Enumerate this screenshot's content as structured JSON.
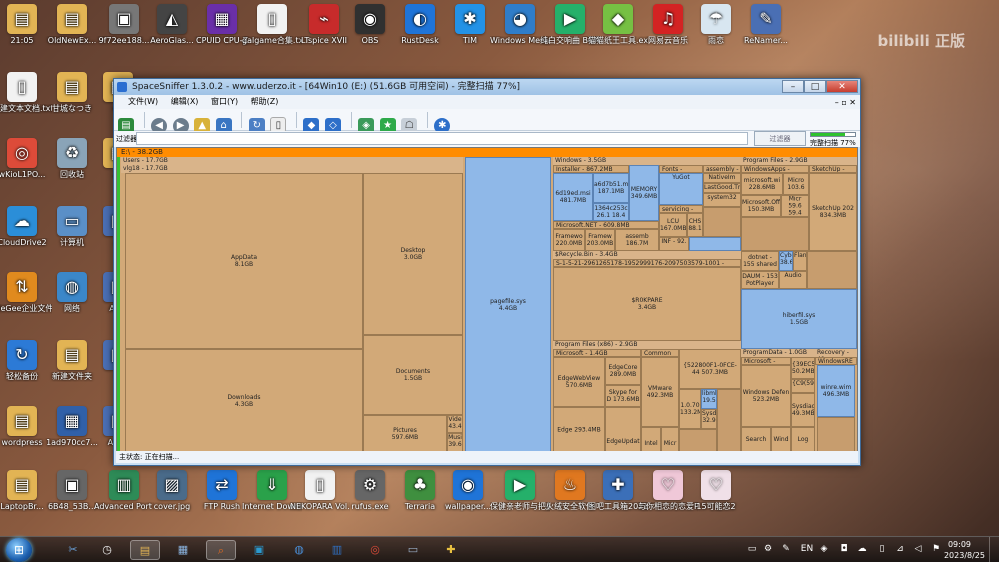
{
  "watermark": "bilibili 正版",
  "desktop_icons": [
    {
      "label": "21:05",
      "color": "#e2b454",
      "glyph": "▤"
    },
    {
      "label": "OldNewEx...",
      "color": "#e2b454",
      "glyph": "▤"
    },
    {
      "label": "9f72ee188...",
      "color": "#777777",
      "glyph": "▣"
    },
    {
      "label": "AeroGlas...",
      "color": "#444444",
      "glyph": "◭"
    },
    {
      "label": "CPUID CPU-Z",
      "color": "#6a2fa8",
      "glyph": "▦"
    },
    {
      "label": "galgame合集.txt",
      "color": "#f2f2f2",
      "glyph": "▯"
    },
    {
      "label": "LTspice XVII",
      "color": "#c72b2b",
      "glyph": "⌁"
    },
    {
      "label": "OBS",
      "color": "#303030",
      "glyph": "◉"
    },
    {
      "label": "RustDesk",
      "color": "#1f74d8",
      "glyph": "◐"
    },
    {
      "label": "TIM",
      "color": "#2392e6",
      "glyph": "✱"
    },
    {
      "label": "Windows Media ...",
      "color": "#2f7dc9",
      "glyph": "◕"
    },
    {
      "label": "纯白交响曲 BGM1.wav",
      "color": "#25b06a",
      "glyph": "▶"
    },
    {
      "label": "猫猫纸王工具.exe",
      "color": "#76c043",
      "glyph": "◆"
    },
    {
      "label": "网易云音乐",
      "color": "#d32323",
      "glyph": "♫"
    },
    {
      "label": "雨恋",
      "color": "#d8e6f0",
      "glyph": "☂"
    },
    {
      "label": "ReNamer...",
      "color": "#4a6fb4",
      "glyph": "✎"
    },
    {
      "label": "新建文本文档.txt",
      "color": "#f2f2f2",
      "glyph": "▯"
    },
    {
      "label": "甘城なつき",
      "color": "#e2b454",
      "glyph": "▤"
    },
    {
      "label": "42",
      "color": "#e2b454",
      "glyph": "▤"
    },
    {
      "label": "wKioL1PO...",
      "color": "#dd4b39",
      "glyph": "◎"
    },
    {
      "label": "回收站",
      "color": "#8aa4b8",
      "glyph": "♻"
    },
    {
      "label": "20",
      "color": "#e2b454",
      "glyph": "▤"
    },
    {
      "label": "CloudDrive2",
      "color": "#2b8ed8",
      "glyph": "☁"
    },
    {
      "label": "计算机",
      "color": "#5a8fc7",
      "glyph": "▭"
    },
    {
      "label": "Al",
      "color": "#4a6fb4",
      "glyph": "▣"
    },
    {
      "label": "FileGee企业文件同步备份...",
      "color": "#e08a1e",
      "glyph": "⇅"
    },
    {
      "label": "网络",
      "color": "#3b87c9",
      "glyph": "◍"
    },
    {
      "label": "A Dr",
      "color": "#4a6fb4",
      "glyph": "▣"
    },
    {
      "label": "轻松备份",
      "color": "#2c7ad6",
      "glyph": "↻"
    },
    {
      "label": "新建文件夹",
      "color": "#e2b454",
      "glyph": "▤"
    },
    {
      "label": "Pl",
      "color": "#4a6fb4",
      "glyph": "▣"
    },
    {
      "label": "wordpress",
      "color": "#e2b454",
      "glyph": "▤"
    },
    {
      "label": "1ad970cc7...",
      "color": "#3060a8",
      "glyph": "▦"
    },
    {
      "label": "A Pro",
      "color": "#4a6fb4",
      "glyph": "▣"
    },
    {
      "label": "LaptopBr...",
      "color": "#e2b454",
      "glyph": "▤"
    },
    {
      "label": "6B48_53B...",
      "color": "#666666",
      "glyph": "▣"
    },
    {
      "label": "Advanced Port Sca...",
      "color": "#2e8b57",
      "glyph": "▥"
    },
    {
      "label": "cover.jpg",
      "color": "#4a6b8a",
      "glyph": "▨"
    },
    {
      "label": "FTP Rush",
      "color": "#1f74d8",
      "glyph": "⇄"
    },
    {
      "label": "Internet Downlo...",
      "color": "#2aa14a",
      "glyph": "⇓"
    },
    {
      "label": "NEKOPARA Vol.3",
      "color": "#f2f2f2",
      "glyph": "▯"
    },
    {
      "label": "rufus.exe",
      "color": "#666666",
      "glyph": "⚙"
    },
    {
      "label": "Terraria",
      "color": "#3f8f3f",
      "glyph": "♣"
    },
    {
      "label": "wallpaper...",
      "color": "#1f74d8",
      "glyph": "◉"
    },
    {
      "label": "保健亲老师与把船泡中高...",
      "color": "#25b06a",
      "glyph": "▶"
    },
    {
      "label": "火绒安全软件",
      "color": "#e07820",
      "glyph": "♨"
    },
    {
      "label": "图吧工具箱2021.exe",
      "color": "#3b6fb8",
      "glyph": "✚"
    },
    {
      "label": "与你相恋的恋爱Recette",
      "color": "#f0c8d8",
      "glyph": "♡"
    },
    {
      "label": "15可能恋2",
      "color": "#f0e0e8",
      "glyph": "♡"
    }
  ],
  "window": {
    "title": "SpaceSniffer 1.3.0.2 - www.uderzo.it - [64Win10 (E:) (51.6GB 可用空间) - 完整扫描 77%]",
    "menu": [
      "文件(W)",
      "编辑(X)",
      "窗口(Y)",
      "帮助(Z)"
    ],
    "filter_label": "过滤器",
    "filter_button": "过滤器",
    "progress_text": "完整扫描 77%",
    "progress_value": 0.77,
    "status": "主状态: 正在扫描...",
    "root": "E:\\ - 38.2GB"
  },
  "treemap": {
    "users": "Users - 17.7GB",
    "vlg": "vlg18 - 17.7GB",
    "appdata_name": "AppData",
    "appdata_size": "8.1GB",
    "desktop_name": "Desktop",
    "desktop_size": "3.0GB",
    "documents_name": "Documents",
    "documents_size": "1.5GB",
    "downloads_name": "Downloads",
    "downloads_size": "4.3GB",
    "pictures_name": "Pictures",
    "pictures_size": "597.6MB",
    "videos": "Vide 43.4",
    "music": "Musi 39.6",
    "pagefile_name": "pagefile.sys",
    "pagefile_size": "4.4GB",
    "windows": "Windows - 3.5GB",
    "installer": "Installer - 867.2MB",
    "installer_a": "6d19ed.msi 481.7MB",
    "installer_b": "a6d7b51.m 187.1MB",
    "installer_c": "1364c253c 26.1 18.4",
    "memory": "MEMORY 349.6MB",
    "fonts": "Fonts - 420.7M",
    "yugoth": "YuGot",
    "assembly": "assembly - 1",
    "nativeim": "NativeIm",
    "lastgood": "LastGood.Tm",
    "system32": "system32",
    "servicing": "servicing -",
    "lcu": "LCU 167.0MB",
    "chs": "CHS 88.1",
    "dotnet": "Microsoft.NET - 609.8MB",
    "framework_a": "Framewo 220.0MB",
    "framework_b": "Framew 203.0MB",
    "assemb": "assemb 186.7M",
    "inf": "INF - 92.",
    "program_files": "Program Files - 2.9GB",
    "windowsapps": "WindowsApps - 1.2GB",
    "microsoft_wi": "microsoft.wi 228.6MB",
    "micro_a": "Micro 103.6",
    "microsoft_off": "Microsoft.Off 150.3MB",
    "micro_b": "Micr 59.6 59.4",
    "sketchup": "SketchUp - 834",
    "sketchup_b": "SketchUp 202 834.3MB",
    "dotnet_box": "dotnet - 155 shared",
    "daum": "DAUM - 153 PotPlayer",
    "cyber": "Cybe 38.6",
    "flantech": "Flantech",
    "audio": "Audio",
    "recycle": "$Recycle.Bin - 3.4GB",
    "sid": "S-1-5-21-2961265178-1952999176-2097503579-1001 - 3.4GB",
    "r0kpare_name": "$R0KPARE",
    "r0kpare_size": "3.4GB",
    "hiberfil_name": "hiberfil.sys",
    "hiberfil_size": "1.5GB",
    "pfx86": "Program Files (x86) - 2.9GB",
    "ms_x86": "Microsoft - 1.4GB",
    "edgewebview": "EdgeWebView 570.6MB",
    "edgecore": "EdgeCore 289.0MB",
    "skype": "Skype for D 173.6MB",
    "edge": "Edge 293.4MB",
    "edgeupdate": "EdgeUpdat",
    "common": "Common File",
    "vmware": "VMware 492.3MB",
    "intel": "Intel",
    "micr": "Micr",
    "guid": "{522800F1-0FCE-44 507.3MB",
    "rec": "1.0.70 133.2M",
    "libml": "libml 19.5",
    "sysd": "Sysd 32.9",
    "programdata": "ProgramData - 1.0GB",
    "ms_pd": "Microsoft - 699.",
    "windows_defender": "Windows Defen 523.2MB",
    "search": "Search",
    "wind": "Wind",
    "recovery": "Recovery - 49",
    "windowsre": "WindowsRE -",
    "winre": "winre.wim 496.3MB",
    "c39ec": "{39EC5 50.2MB",
    "c9": "{C9(59",
    "sysdiag": "Sysdiag 49.3MB",
    "log": "Log"
  },
  "taskbar": {
    "items": [
      {
        "glyph": "✂",
        "color": "#6aa0d8"
      },
      {
        "glyph": "◷",
        "color": "#f0f0f0"
      },
      {
        "glyph": "▤",
        "color": "#e2b454"
      },
      {
        "glyph": "▦",
        "color": "#8ab4e0"
      },
      {
        "glyph": "⌕",
        "color": "#e06a20"
      },
      {
        "glyph": "▣",
        "color": "#2a9ad0"
      },
      {
        "glyph": "◍",
        "color": "#4a8fd8"
      },
      {
        "glyph": "▥",
        "color": "#2f6fc0"
      },
      {
        "glyph": "◎",
        "color": "#dd4b39"
      },
      {
        "glyph": "▭",
        "color": "#9bb0c8"
      },
      {
        "glyph": "✚",
        "color": "#e8c040"
      }
    ],
    "lang": "EN",
    "time": "09:09",
    "date": "2023/8/25"
  }
}
